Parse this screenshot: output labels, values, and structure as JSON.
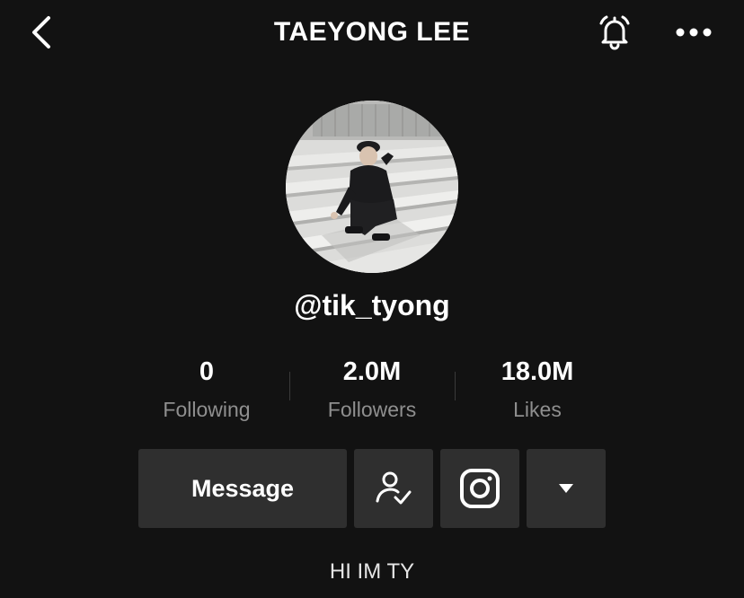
{
  "header": {
    "title": "TAEYONG LEE",
    "back_icon": "chevron-left-icon",
    "bell_icon": "bell-icon",
    "more_icon": "ellipsis-icon"
  },
  "profile": {
    "username": "@tik_tyong",
    "bio": "HI IM TY"
  },
  "stats": [
    {
      "value": "0",
      "label": "Following"
    },
    {
      "value": "2.0M",
      "label": "Followers"
    },
    {
      "value": "18.0M",
      "label": "Likes"
    }
  ],
  "actions": {
    "message_label": "Message",
    "follow_icon": "user-check-icon",
    "instagram_icon": "instagram-icon",
    "dropdown_icon": "caret-down-icon"
  },
  "colors": {
    "background": "#121212",
    "button_bg": "#2f2f2f",
    "muted_text": "#8f8f8f"
  }
}
